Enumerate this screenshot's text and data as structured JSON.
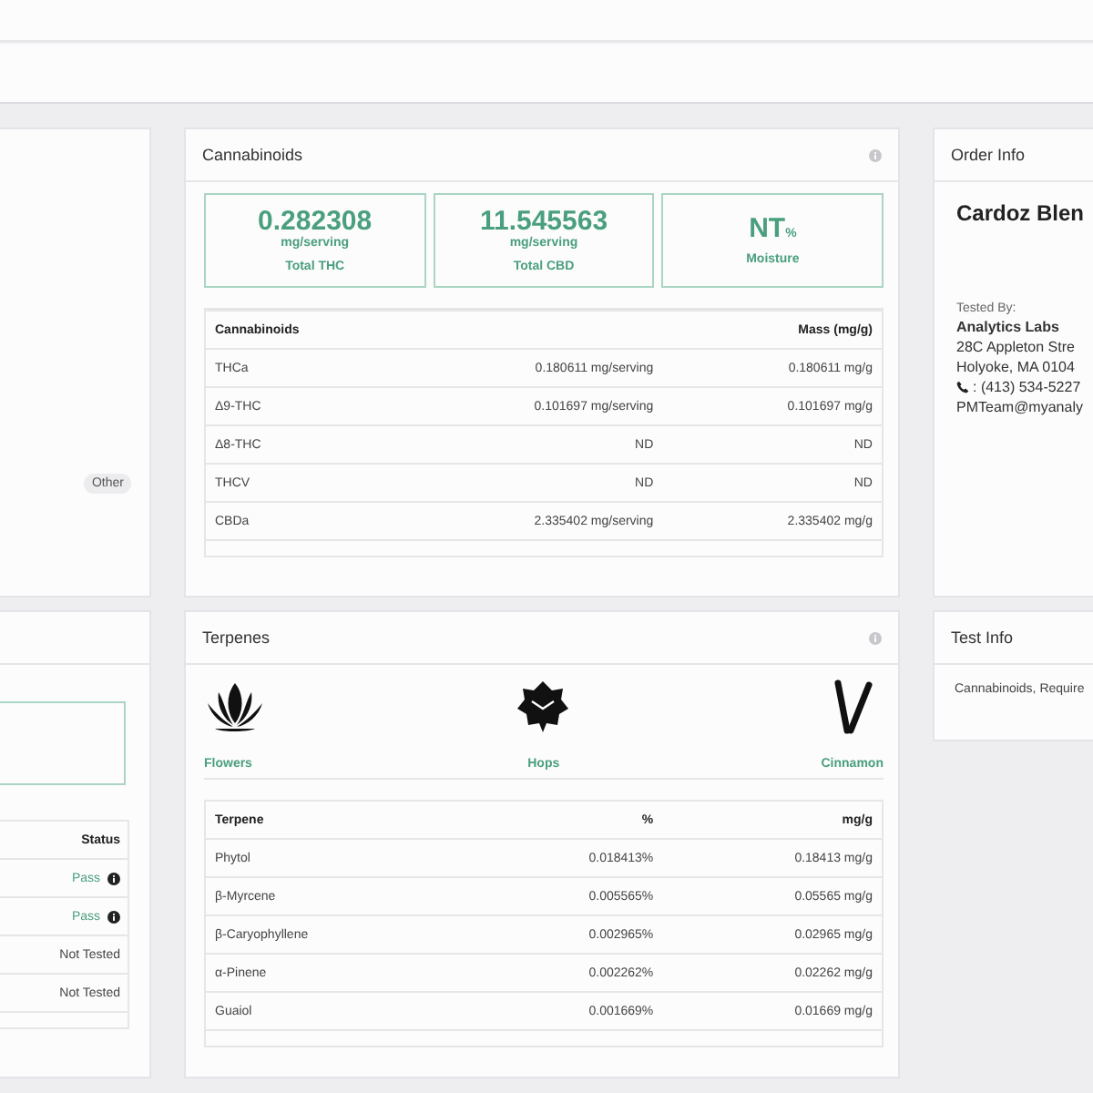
{
  "left_top_card": {
    "badge": "Other"
  },
  "left_bottom_card": {
    "status_table": {
      "columns": [
        "Status"
      ],
      "rows": [
        {
          "status": "Pass",
          "kind": "pass"
        },
        {
          "status": "Pass",
          "kind": "pass"
        },
        {
          "status": "Not Tested",
          "kind": "not_tested"
        },
        {
          "status": "Not Tested",
          "kind": "not_tested"
        }
      ]
    }
  },
  "cannabinoids": {
    "title": "Cannabinoids",
    "stats": [
      {
        "value": "0.282308",
        "unit": "mg/serving",
        "label": "Total THC",
        "kind": "below"
      },
      {
        "value": "11.545563",
        "unit": "mg/serving",
        "label": "Total CBD",
        "kind": "below"
      },
      {
        "value": "NT",
        "unit": "%",
        "label": "Moisture",
        "kind": "inline"
      }
    ],
    "table": {
      "columns": [
        "Cannabinoids",
        "",
        "Mass (mg/g)"
      ],
      "rows": [
        [
          "THCa",
          "0.180611 mg/serving",
          "0.180611 mg/g"
        ],
        [
          "Δ9-THC",
          "0.101697 mg/serving",
          "0.101697 mg/g"
        ],
        [
          "Δ8-THC",
          "ND",
          "ND"
        ],
        [
          "THCV",
          "ND",
          "ND"
        ],
        [
          "CBDa",
          "2.335402 mg/serving",
          "2.335402 mg/g"
        ]
      ]
    }
  },
  "terpenes": {
    "title": "Terpenes",
    "aromas": [
      {
        "label": "Flowers",
        "kind": "flower"
      },
      {
        "label": "Hops",
        "kind": "hops"
      },
      {
        "label": "Cinnamon",
        "kind": "cinnamon"
      }
    ],
    "table": {
      "columns": [
        "Terpene",
        "%",
        "mg/g"
      ],
      "rows": [
        [
          "Phytol",
          "0.018413%",
          "0.18413 mg/g"
        ],
        [
          "β-Myrcene",
          "0.005565%",
          "0.05565 mg/g"
        ],
        [
          "β-Caryophyllene",
          "0.002965%",
          "0.02965 mg/g"
        ],
        [
          "α-Pinene",
          "0.002262%",
          "0.02262 mg/g"
        ],
        [
          "Guaiol",
          "0.001669%",
          "0.01669 mg/g"
        ]
      ]
    }
  },
  "order_info": {
    "title": "Order Info",
    "product": "Cardoz Blen",
    "tested_by_label": "Tested By:",
    "lab": "Analytics Labs",
    "address_lines": [
      "28C Appleton Stre",
      "Holyoke, MA 0104"
    ],
    "phone": ": (413) 534-5227",
    "email": "PMTeam@myanaly"
  },
  "test_info": {
    "title": "Test Info",
    "tests": "Cannabinoids, Require"
  }
}
